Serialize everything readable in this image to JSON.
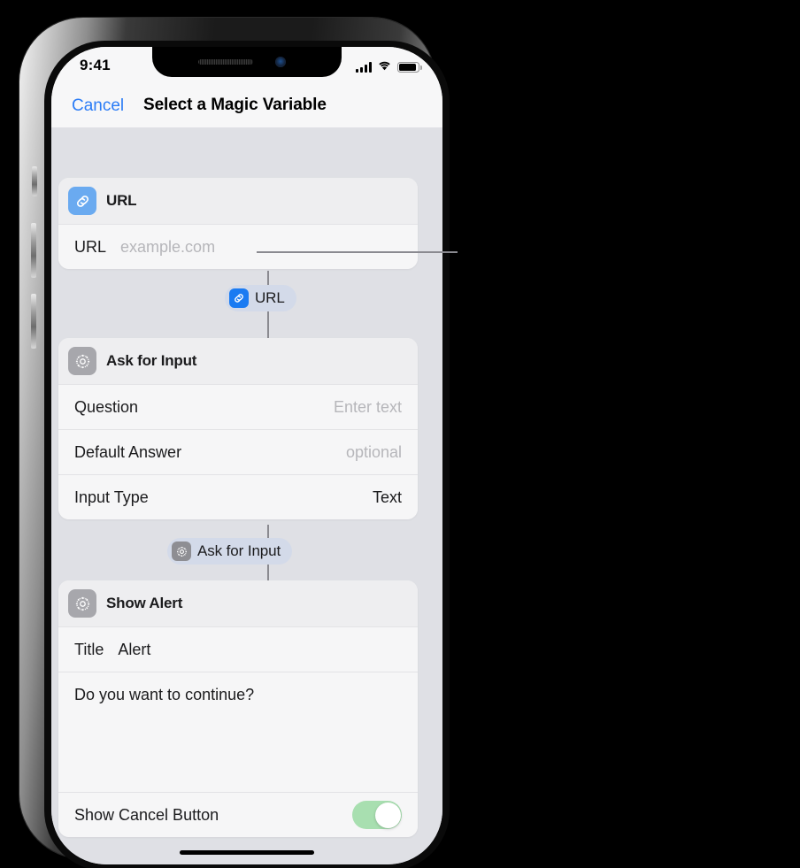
{
  "status_bar": {
    "time": "9:41",
    "cellular_icon": "signal-bars-icon",
    "wifi_icon": "wifi-icon",
    "battery_icon": "battery-icon"
  },
  "nav_bar": {
    "cancel_label": "Cancel",
    "title": "Select a Magic Variable"
  },
  "colors": {
    "accent_blue": "#2b7cf6",
    "url_icon_blue": "#6aaaf0",
    "pill_icon_blue": "#1a7bf2",
    "gear_icon_gray": "#a7a7ac",
    "pill_background": "#d3dae9",
    "toggle_on_green": "#a8dfb0",
    "screen_background": "#dfe0e5",
    "card_background": "#f6f6f7",
    "connector_gray": "#8a8a90"
  },
  "actions": [
    {
      "icon": "link-icon",
      "title": "URL",
      "rows": [
        {
          "type": "inline",
          "label": "URL",
          "value": "example.com",
          "is_placeholder": true
        }
      ]
    },
    {
      "icon": "gear-icon",
      "title": "Ask for Input",
      "rows": [
        {
          "type": "label-value",
          "label": "Question",
          "value": "Enter text",
          "is_placeholder": true
        },
        {
          "type": "label-value",
          "label": "Default Answer",
          "value": "optional",
          "is_placeholder": true
        },
        {
          "type": "label-value",
          "label": "Input Type",
          "value": "Text",
          "is_placeholder": false
        }
      ]
    },
    {
      "icon": "gear-icon",
      "title": "Show Alert",
      "rows": [
        {
          "type": "inline",
          "label": "Title",
          "value": "Alert",
          "is_placeholder": false
        },
        {
          "type": "textarea",
          "value": "Do you want to continue?"
        },
        {
          "type": "toggle",
          "label": "Show Cancel Button",
          "value": "on"
        }
      ]
    }
  ],
  "magic_variables": [
    {
      "icon": "link-icon",
      "label": "URL",
      "has_callout": true
    },
    {
      "icon": "gear-icon",
      "label": "Ask for Input",
      "has_callout": false
    }
  ],
  "device": {
    "speaker_icon": "speaker-grille-icon",
    "camera_icon": "front-camera-icon",
    "home_indicator_icon": "home-indicator-icon",
    "mute_switch_icon": "mute-switch-icon",
    "volume_up_icon": "volume-up-button-icon",
    "volume_down_icon": "volume-down-button-icon",
    "power_icon": "power-button-icon"
  }
}
